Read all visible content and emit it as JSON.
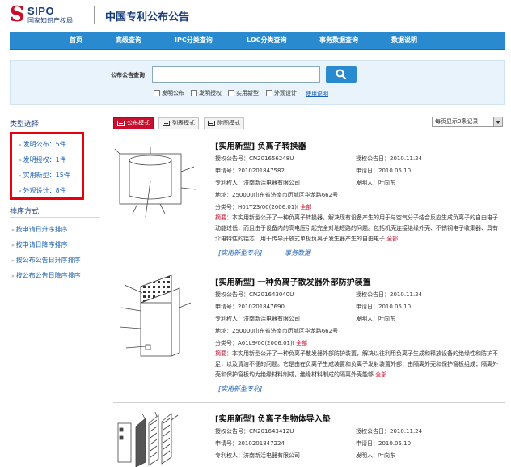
{
  "header": {
    "logo_mark": "S",
    "logo_text": "SIPO",
    "logo_subtitle": "国家知识产权局",
    "site_title": "中国专利公布公告"
  },
  "nav": [
    "首页",
    "高级查询",
    "IPC分类查询",
    "LOC分类查询",
    "事务数据查询",
    "数据说明"
  ],
  "search": {
    "label": "公布公告查询",
    "value": "",
    "checkboxes": [
      "发明公布",
      "发明授权",
      "实用新型",
      "外观设计"
    ],
    "help": "使用说明"
  },
  "sidebar": {
    "type_title": "类型选择",
    "types": [
      "发明公布：5件",
      "发明授权：1件",
      "实用新型：15件",
      "外观设计：8件"
    ],
    "sort_title": "排序方式",
    "sorts": [
      "按申请日升序排序",
      "按申请日降序排序",
      "按公布公告日升序排序",
      "按公布公告日降序排序"
    ]
  },
  "tabs": [
    "公布模式",
    "列表模式",
    "附图模式"
  ],
  "per_page": "每页显示3条记录",
  "records": [
    {
      "title": "[实用新型] 负离子转换器",
      "auth_no": "授权公告号：CN201656248U",
      "auth_date": "授权公告日：2010.11.24",
      "app_no": "申请号：2010201847582",
      "app_date": "申请日：2010.05.10",
      "owner": "专利权人：济南新活电器有限公司",
      "inventor": "发明人：叶向东",
      "address": "地址：250000山东省济南市历城区华龙路662号",
      "class_no": "分类号：H01T23/00(2006.01)I",
      "all": "全部",
      "abstract_label": "摘要：",
      "abstract": "本实用新型公开了一种负离子转换器，解决现有设备产生的用于与空气分子结合反应生成负离子的自由电子动能过低，而且由于设备内的高电压引起完全对地短路的问题。包括机壳连接绝缘外壳、不锈钢电子收集器、具有介电特性的铝芯，用于传导开放式单极负离子发生器产生的自由电子",
      "abstract_all": "全部",
      "links": [
        "[实用新型专利]",
        "事务数据"
      ]
    },
    {
      "title": "[实用新型] 一种负离子散发器外部防护装置",
      "auth_no": "授权公告号：CN201643040U",
      "auth_date": "授权公告日：2010.11.24",
      "app_no": "申请号：2010201847690",
      "app_date": "申请日：2010.05.10",
      "owner": "专利权人：济南新活电器有限公司",
      "inventor": "发明人：叶向东",
      "address": "地址：250000山东省济南市历城区华龙路662号",
      "class_no": "分类号：A61L9/00(2006.01)I",
      "all": "全部",
      "abstract_label": "摘要：",
      "abstract": "本实用新型公开了一种负离子散发器外部防护装置，解决以往利用负离子生成和释放设备的绝缘性和防护不足，以及清洁不便的问题。它是由在负离子生成装置和负离子发射装置外部：由隔离外壳和保护窗板组成；隔离外壳和保护窗板均为绝缘材料制成，绝缘材料制成的隔离外壳能够",
      "abstract_all": "全部",
      "links": [
        "[实用新型专利]"
      ]
    },
    {
      "title": "[实用新型] 负离子生物体导入垫",
      "auth_no": "授权公告号：CN201643412U",
      "auth_date": "授权公告日：2010.11.24",
      "app_no": "申请号：2010201847224",
      "app_date": "申请日：2010.05.10",
      "owner": "专利权人：济南新活电器有限公司",
      "inventor": "发明人：叶向东"
    }
  ],
  "colors": {
    "nav": "#2a8ad0",
    "highlight_box": "#e8000d",
    "title_blue": "#1a3d7c",
    "link_blue": "#1a5fb4",
    "accent_red": "#c8102e"
  }
}
